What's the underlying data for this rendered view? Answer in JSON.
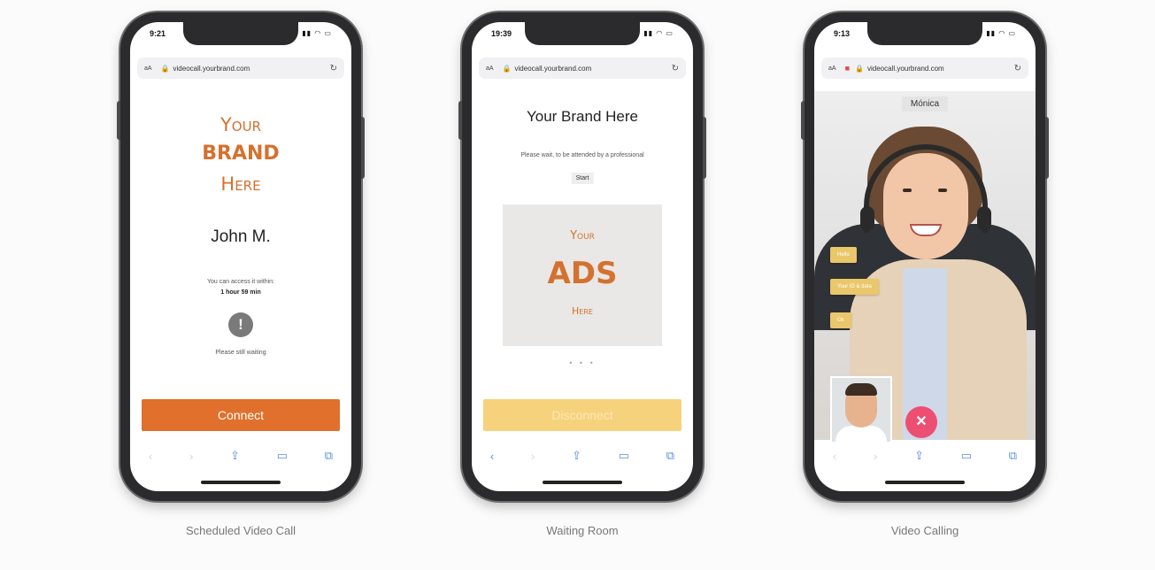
{
  "phones": [
    {
      "time": "9:21",
      "url": "videocall.yourbrand.com",
      "brand_line1": "Your",
      "brand_line2": "BRAND",
      "brand_line3": "Here",
      "user_name": "John M.",
      "access_line1": "You can access it within:",
      "access_line2": "1 hour 59 min",
      "waiting_text": "Please still waiting",
      "connect_label": "Connect",
      "caption": "Scheduled Video Call"
    },
    {
      "time": "19:39",
      "url": "videocall.yourbrand.com",
      "title": "Your Brand Here",
      "wait_text": "Please wait, to be attended by a professional",
      "start_tag": "Start",
      "ads_line1": "Your",
      "ads_line2": "ADS",
      "ads_line3": "Here",
      "dots": "• • •",
      "disconnect_label": "Disconnect",
      "caption": "Waiting Room"
    },
    {
      "time": "9:13",
      "url": "videocall.yourbrand.com",
      "caller_name": "Mónica",
      "chips": [
        "Hello",
        "Your ID & data",
        "Ok"
      ],
      "caption": "Video Calling"
    }
  ],
  "colors": {
    "brand_orange": "#d5712e",
    "connect_orange": "#e0702c",
    "disconnect_yellow": "#f7d27d",
    "hangup_pink": "#ec4f72"
  },
  "icons": {
    "toolbar": [
      "back-icon",
      "forward-icon",
      "share-icon",
      "bookmarks-icon",
      "tabs-icon"
    ]
  }
}
